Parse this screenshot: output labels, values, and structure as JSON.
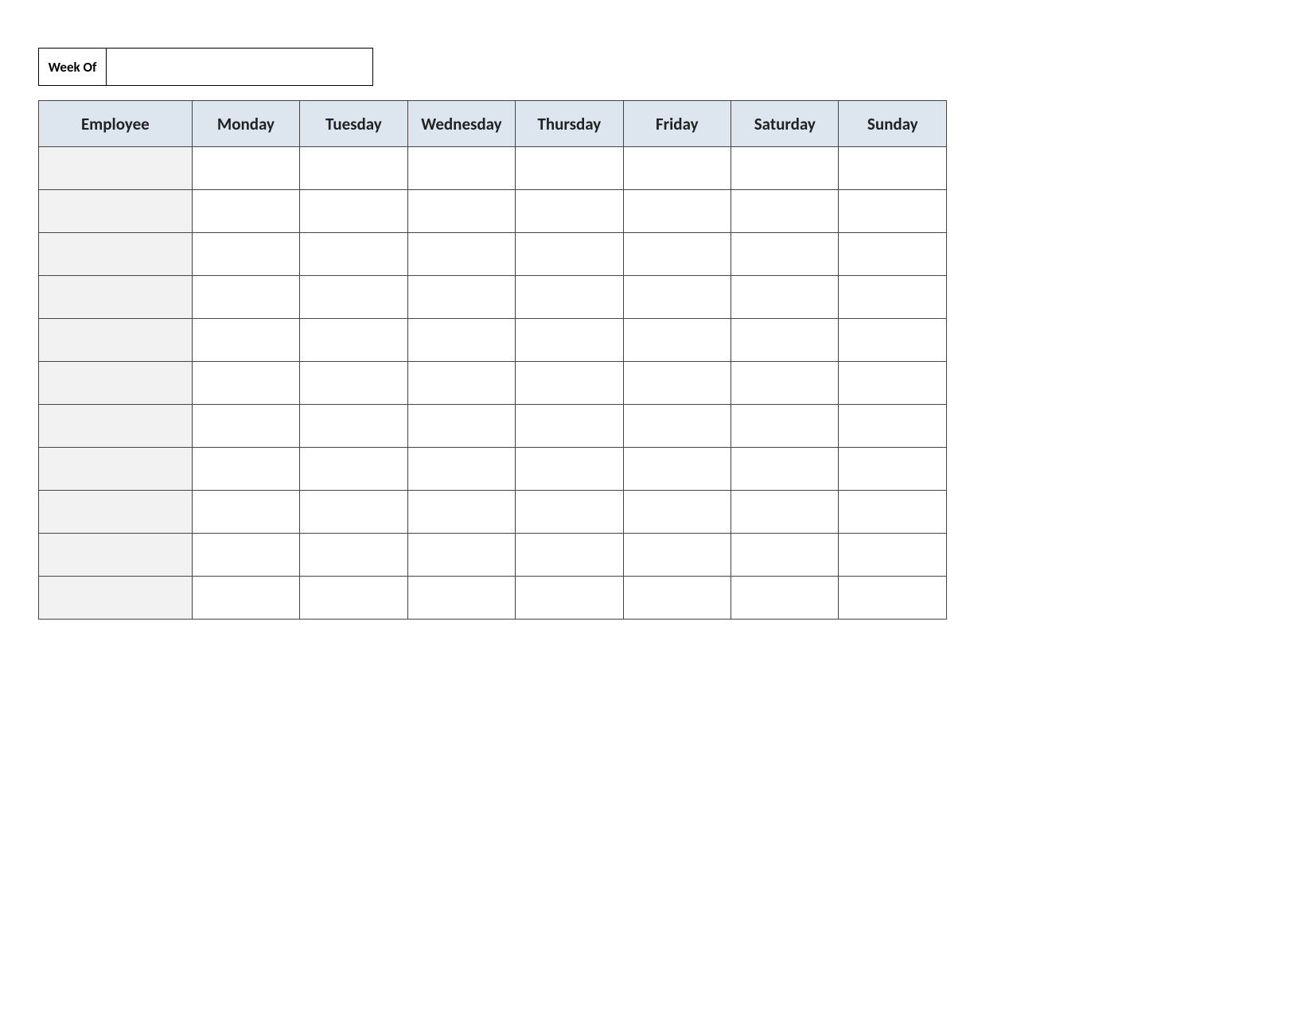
{
  "week_of": {
    "label": "Week Of",
    "value": ""
  },
  "columns": [
    "Employee",
    "Monday",
    "Tuesday",
    "Wednesday",
    "Thursday",
    "Friday",
    "Saturday",
    "Sunday"
  ],
  "rows": [
    {
      "employee": "",
      "mon": "",
      "tue": "",
      "wed": "",
      "thu": "",
      "fri": "",
      "sat": "",
      "sun": ""
    },
    {
      "employee": "",
      "mon": "",
      "tue": "",
      "wed": "",
      "thu": "",
      "fri": "",
      "sat": "",
      "sun": ""
    },
    {
      "employee": "",
      "mon": "",
      "tue": "",
      "wed": "",
      "thu": "",
      "fri": "",
      "sat": "",
      "sun": ""
    },
    {
      "employee": "",
      "mon": "",
      "tue": "",
      "wed": "",
      "thu": "",
      "fri": "",
      "sat": "",
      "sun": ""
    },
    {
      "employee": "",
      "mon": "",
      "tue": "",
      "wed": "",
      "thu": "",
      "fri": "",
      "sat": "",
      "sun": ""
    },
    {
      "employee": "",
      "mon": "",
      "tue": "",
      "wed": "",
      "thu": "",
      "fri": "",
      "sat": "",
      "sun": ""
    },
    {
      "employee": "",
      "mon": "",
      "tue": "",
      "wed": "",
      "thu": "",
      "fri": "",
      "sat": "",
      "sun": ""
    },
    {
      "employee": "",
      "mon": "",
      "tue": "",
      "wed": "",
      "thu": "",
      "fri": "",
      "sat": "",
      "sun": ""
    },
    {
      "employee": "",
      "mon": "",
      "tue": "",
      "wed": "",
      "thu": "",
      "fri": "",
      "sat": "",
      "sun": ""
    },
    {
      "employee": "",
      "mon": "",
      "tue": "",
      "wed": "",
      "thu": "",
      "fri": "",
      "sat": "",
      "sun": ""
    },
    {
      "employee": "",
      "mon": "",
      "tue": "",
      "wed": "",
      "thu": "",
      "fri": "",
      "sat": "",
      "sun": ""
    }
  ]
}
